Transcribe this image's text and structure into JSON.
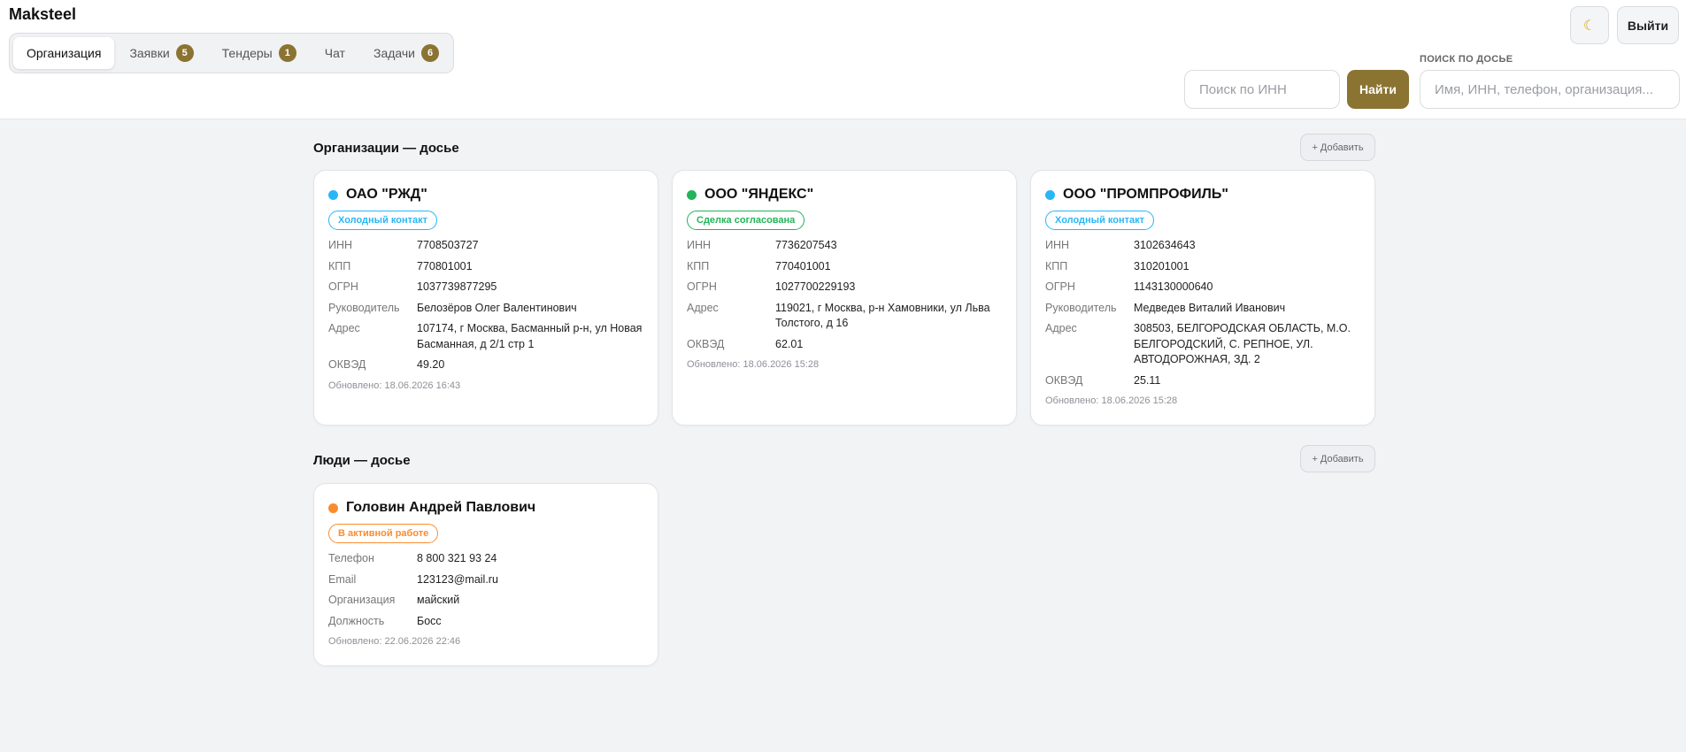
{
  "app": {
    "title": "Maksteel"
  },
  "tabs": [
    {
      "label": "Организация",
      "badge": null
    },
    {
      "label": "Заявки",
      "badge": "5"
    },
    {
      "label": "Тендеры",
      "badge": "1"
    },
    {
      "label": "Чат",
      "badge": null
    },
    {
      "label": "Задачи",
      "badge": "6"
    }
  ],
  "header": {
    "theme_icon": "☾",
    "logout_label": "Выйти",
    "inn_placeholder": "Поиск по ИНН",
    "find_label": "Найти",
    "dossier_search_label": "ПОИСК ПО ДОСЬЕ",
    "dossier_placeholder": "Имя, ИНН, телефон, организация..."
  },
  "organizations": {
    "title": "Организации — досье",
    "add_label": "+ Добавить",
    "cards": [
      {
        "name": "ОАО \"РЖД\"",
        "dot_color": "#29b6f6",
        "status": "Холодный контакт",
        "status_color": "#29b6f6",
        "fields": [
          {
            "k": "ИНН",
            "v": "7708503727"
          },
          {
            "k": "КПП",
            "v": "770801001"
          },
          {
            "k": "ОГРН",
            "v": "1037739877295"
          },
          {
            "k": "Руководитель",
            "v": "Белозёров Олег Валентинович"
          },
          {
            "k": "Адрес",
            "v": "107174, г Москва, Басманный р-н, ул Новая Басманная, д 2/1 стр 1"
          },
          {
            "k": "ОКВЭД",
            "v": "49.20"
          }
        ],
        "updated": "Обновлено: 18.06.2026 16:43"
      },
      {
        "name": "ООО \"ЯНДЕКС\"",
        "dot_color": "#22b45a",
        "status": "Сделка согласована",
        "status_color": "#22b45a",
        "fields": [
          {
            "k": "ИНН",
            "v": "7736207543"
          },
          {
            "k": "КПП",
            "v": "770401001"
          },
          {
            "k": "ОГРН",
            "v": "1027700229193"
          },
          {
            "k": "Адрес",
            "v": "119021, г Москва, р-н Хамовники, ул Льва Толстого, д 16"
          },
          {
            "k": "ОКВЭД",
            "v": "62.01"
          }
        ],
        "updated": "Обновлено: 18.06.2026 15:28"
      },
      {
        "name": "ООО \"ПРОМПРОФИЛЬ\"",
        "dot_color": "#29b6f6",
        "status": "Холодный контакт",
        "status_color": "#29b6f6",
        "fields": [
          {
            "k": "ИНН",
            "v": "3102634643"
          },
          {
            "k": "КПП",
            "v": "310201001"
          },
          {
            "k": "ОГРН",
            "v": "1143130000640"
          },
          {
            "k": "Руководитель",
            "v": "Медведев Виталий Иванович"
          },
          {
            "k": "Адрес",
            "v": "308503, БЕЛГОРОДСКАЯ ОБЛАСТЬ, М.О. БЕЛГОРОДСКИЙ, С. РЕПНОЕ, УЛ. АВТОДОРОЖНАЯ, ЗД. 2"
          },
          {
            "k": "ОКВЭД",
            "v": "25.11"
          }
        ],
        "updated": "Обновлено: 18.06.2026 15:28"
      }
    ]
  },
  "people": {
    "title": "Люди — досье",
    "add_label": "+ Добавить",
    "cards": [
      {
        "name": "Головин Андрей Павлович",
        "dot_color": "#fb8c2e",
        "status": "В активной работе",
        "status_color": "#fb8c2e",
        "fields": [
          {
            "k": "Телефон",
            "v": "8 800 321 93 24"
          },
          {
            "k": "Email",
            "v": "123123@mail.ru"
          },
          {
            "k": "Организация",
            "v": "майский"
          },
          {
            "k": "Должность",
            "v": "Босс"
          }
        ],
        "updated": "Обновлено: 22.06.2026 22:46"
      }
    ]
  }
}
